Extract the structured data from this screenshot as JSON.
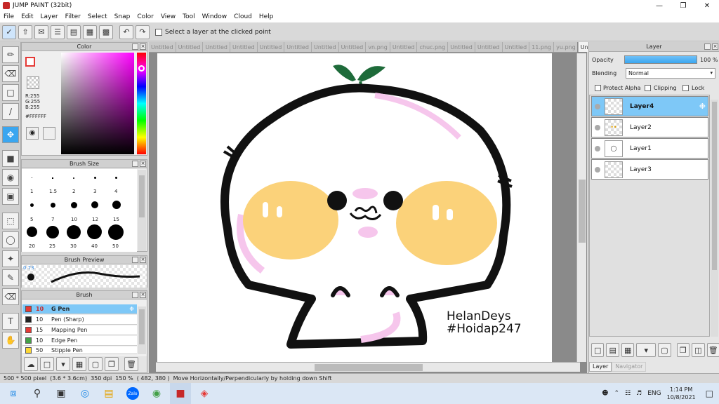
{
  "window": {
    "title": "JUMP PAINT (32bit)"
  },
  "menu": [
    "File",
    "Edit",
    "Layer",
    "Filter",
    "Select",
    "Snap",
    "Color",
    "View",
    "Tool",
    "Window",
    "Cloud",
    "Help"
  ],
  "toolbar": {
    "select_layer_label": "Select a layer at the clicked point"
  },
  "color_panel": {
    "title": "Color",
    "r": "R:255",
    "g": "G:255",
    "b": "B:255",
    "hex": "#FFFFFF"
  },
  "brush_size": {
    "title": "Brush Size",
    "sizes": [
      "1",
      "1.5",
      "2",
      "3",
      "4",
      "5",
      "7",
      "10",
      "12",
      "15",
      "20",
      "25",
      "30",
      "40",
      "50"
    ]
  },
  "brush_preview": {
    "title": "Brush Preview",
    "value": "0.73"
  },
  "brush_panel": {
    "title": "Brush",
    "items": [
      {
        "size": "10",
        "name": "G Pen",
        "color": "#e53935",
        "active": true
      },
      {
        "size": "10",
        "name": "Pen (Sharp)",
        "color": "#222222",
        "active": false
      },
      {
        "size": "15",
        "name": "Mapping Pen",
        "color": "#e53935",
        "active": false
      },
      {
        "size": "10",
        "name": "Edge Pen",
        "color": "#43a047",
        "active": false
      },
      {
        "size": "50",
        "name": "Stipple Pen",
        "color": "#fdd835",
        "active": false
      }
    ]
  },
  "tabs": [
    "Untitled",
    "Untitled",
    "Untitled",
    "Untitled",
    "Untitled",
    "Untitled",
    "Untitled",
    "Untitled",
    "vn.png",
    "Untitled",
    "chuc.png",
    "Untitled",
    "Untitled",
    "Untitled",
    "11.png",
    "yu.png",
    "Untitled"
  ],
  "canvas": {
    "watermark_line1": "HelanDeys",
    "watermark_line2": "#Hoidap247"
  },
  "layer_panel": {
    "title": "Layer",
    "opacity_label": "Opacity",
    "opacity_value": "100 %",
    "blending_label": "Blending",
    "blending_value": "Normal",
    "protect_alpha": "Protect Alpha",
    "clipping": "Clipping",
    "lock": "Lock",
    "layers": [
      {
        "name": "Layer4",
        "active": true
      },
      {
        "name": "Layer2",
        "active": false
      },
      {
        "name": "Layer1",
        "active": false
      },
      {
        "name": "Layer3",
        "active": false
      }
    ],
    "bottom_tabs": [
      "Layer",
      "Navigator"
    ]
  },
  "status": {
    "size": "500 * 500 pixel",
    "phys": "(3.6 * 3.6cm)",
    "dpi": "350 dpi",
    "zoom": "150 %",
    "coords": "( 482, 380 )",
    "hint": "Move Horizontally/Perpendicularly by holding down Shift"
  },
  "taskbar": {
    "lang": "ENG",
    "time": "1:14 PM",
    "date": "10/8/2021",
    "zalo": "Zalo"
  }
}
